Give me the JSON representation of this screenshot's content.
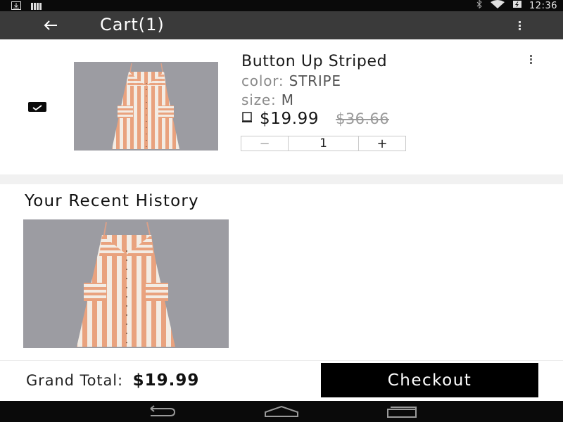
{
  "status_bar": {
    "time": "12:36",
    "icons": [
      "download-icon",
      "bars-icon",
      "bluetooth-icon",
      "wifi-icon",
      "battery-icon"
    ]
  },
  "app_bar": {
    "title": "Cart(1)",
    "back_icon": "arrow-left-icon",
    "menu_icon": "more-vertical-icon"
  },
  "cart_item": {
    "checked": true,
    "name": "Button Up Striped",
    "color_label": "color:",
    "color_value": "STRIPE",
    "size_label": "size:",
    "size_value": "M",
    "price": "$19.99",
    "old_price": "$36.66",
    "quantity": "1",
    "minus_label": "−",
    "plus_label": "+",
    "device_icon": "phone-icon",
    "menu_icon": "more-vertical-icon"
  },
  "history": {
    "title": "Your Recent History"
  },
  "footer": {
    "grand_label": "Grand Total:",
    "grand_amount": "$19.99",
    "checkout_label": "Checkout"
  },
  "nav_bar": {
    "icons": [
      "back-nav-icon",
      "home-nav-icon",
      "recents-nav-icon"
    ]
  },
  "colors": {
    "app_bar": "#3a3a3a",
    "checkout": "#000000",
    "stripe_orange": "#e9a27e",
    "stripe_white": "#f4efe8"
  }
}
